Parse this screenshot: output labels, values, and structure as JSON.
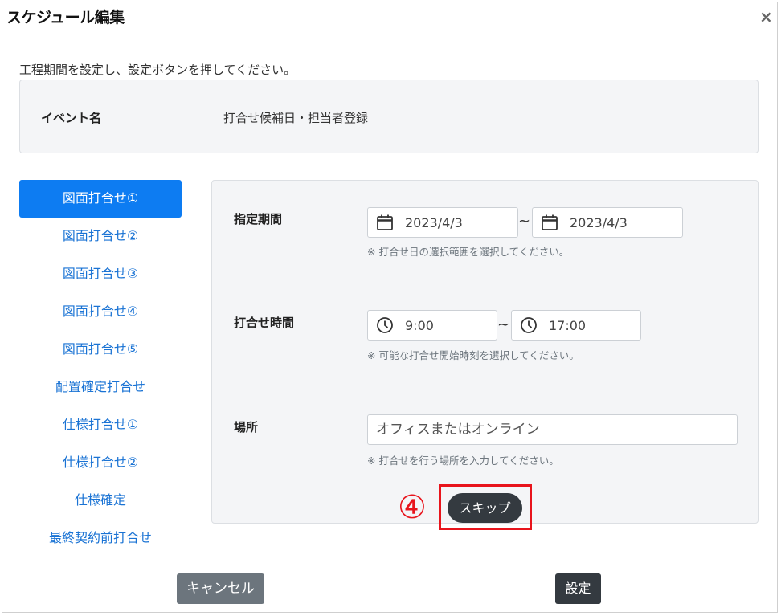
{
  "dialog": {
    "title": "スケジュール編集",
    "close_glyph": "×",
    "instruction": "工程期間を設定し、設定ボタンを押してください。"
  },
  "event": {
    "label": "イベント名",
    "value": "打合せ候補日・担当者登録"
  },
  "sidebar": {
    "items": [
      {
        "label": "図面打合せ①",
        "active": true
      },
      {
        "label": "図面打合せ②"
      },
      {
        "label": "図面打合せ③"
      },
      {
        "label": "図面打合せ④"
      },
      {
        "label": "図面打合せ⑤"
      },
      {
        "label": "配置確定打合せ"
      },
      {
        "label": "仕様打合せ①"
      },
      {
        "label": "仕様打合せ②"
      },
      {
        "label": "仕様確定"
      },
      {
        "label": "最終契約前打合せ"
      }
    ]
  },
  "form": {
    "period": {
      "label": "指定期間",
      "start": "2023/4/3",
      "end": "2023/4/3",
      "separator": "~",
      "hint": "※ 打合せ日の選択範囲を選択してください。"
    },
    "time": {
      "label": "打合せ時間",
      "start": "9:00",
      "end": "17:00",
      "separator": "~",
      "hint": "※ 可能な打合せ開始時刻を選択してください。"
    },
    "place": {
      "label": "場所",
      "placeholder": "オフィスまたはオンライン",
      "hint": "※ 打合せを行う場所を入力してください。"
    },
    "skip_label": "スキップ"
  },
  "annotation": {
    "step_marker": "④",
    "color": "#e8141c"
  },
  "footer": {
    "cancel_label": "キャンセル",
    "set_label": "設定"
  },
  "colors": {
    "accent": "#0d7cf2",
    "link": "#1a73d4",
    "dark_button": "#343a40",
    "secondary_button": "#6c757d"
  }
}
